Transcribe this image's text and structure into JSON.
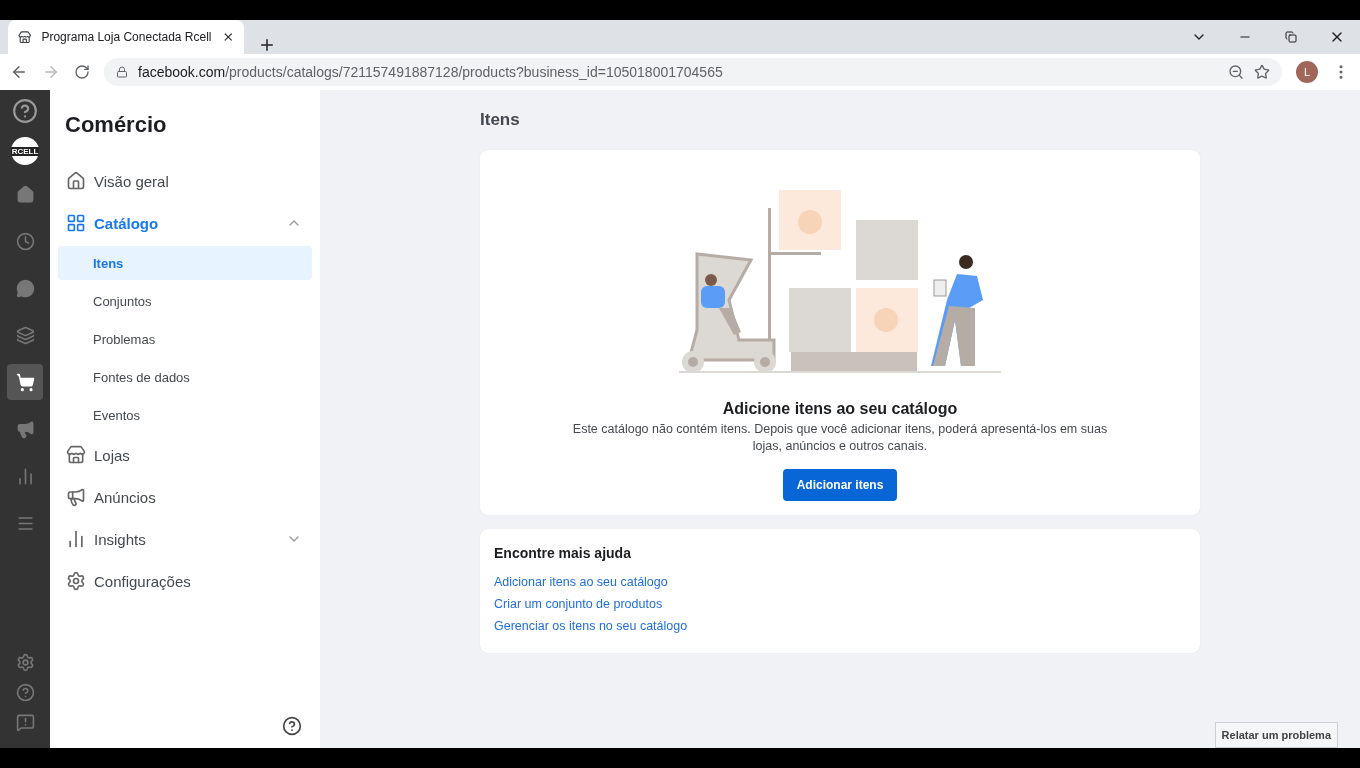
{
  "browser": {
    "tab_title": "Programa Loja Conectada Rcell",
    "url_domain": "facebook.com",
    "url_path": "/products/catalogs/721157491887128/products?business_id=105018001704565",
    "profile_initial": "L"
  },
  "rail": {
    "items": [
      {
        "kind": "home",
        "selected": false
      },
      {
        "kind": "clock",
        "selected": false
      },
      {
        "kind": "chat",
        "selected": false
      },
      {
        "kind": "pages",
        "selected": false
      },
      {
        "kind": "cart",
        "selected": true
      },
      {
        "kind": "megaphone",
        "selected": false
      },
      {
        "kind": "chart",
        "selected": false
      },
      {
        "kind": "menu",
        "selected": false
      }
    ],
    "logo_text": "RCELL"
  },
  "sidebar": {
    "title": "Comércio",
    "items": [
      {
        "label": "Visão geral",
        "kind": "home",
        "selected": false
      },
      {
        "label": "Catálogo",
        "kind": "grid",
        "selected": true,
        "expanded": true,
        "children": [
          {
            "label": "Itens",
            "selected": true
          },
          {
            "label": "Conjuntos",
            "selected": false
          },
          {
            "label": "Problemas",
            "selected": false
          },
          {
            "label": "Fontes de dados",
            "selected": false
          },
          {
            "label": "Eventos",
            "selected": false
          }
        ]
      },
      {
        "label": "Lojas",
        "kind": "store",
        "selected": false
      },
      {
        "label": "Anúncios",
        "kind": "megaphone",
        "selected": false
      },
      {
        "label": "Insights",
        "kind": "chart",
        "selected": false,
        "expanded": false
      },
      {
        "label": "Configurações",
        "kind": "gear",
        "selected": false
      }
    ]
  },
  "main": {
    "heading": "Itens",
    "empty_card": {
      "title": "Adicione itens ao seu catálogo",
      "description": "Este catálogo não contém itens. Depois que você adicionar itens, poderá apresentá-los em suas lojas, anúncios e outros canais.",
      "button": "Adicionar itens"
    },
    "help_card": {
      "title": "Encontre mais ajuda",
      "links": [
        "Adicionar itens ao seu catálogo",
        "Criar um conjunto de produtos",
        "Gerenciar os itens no seu catálogo"
      ]
    }
  },
  "report_button": "Relatar um problema"
}
